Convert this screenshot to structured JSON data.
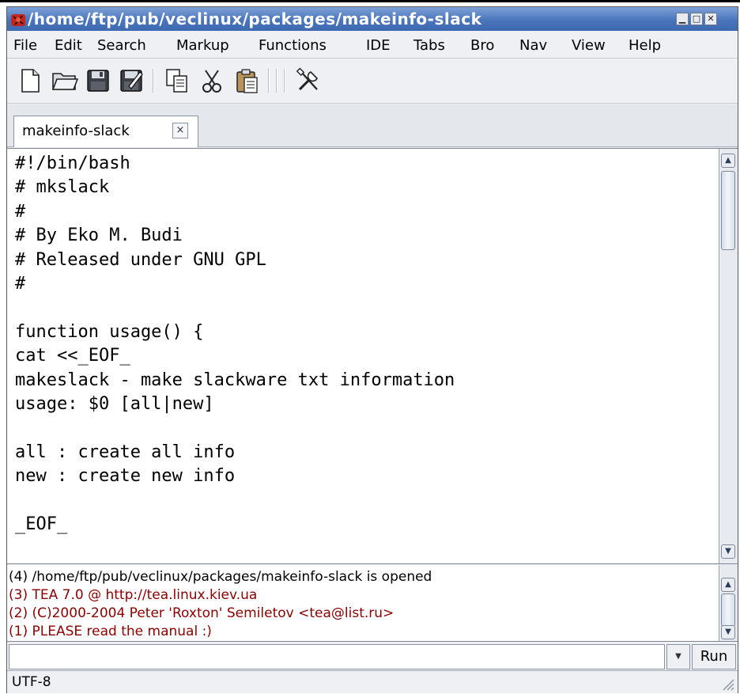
{
  "window": {
    "title": "/home/ftp/pub/veclinux/packages/makeinfo-slack",
    "controls": {
      "minimize": "▁",
      "maximize": "□",
      "close": "✕"
    }
  },
  "menubar": {
    "items": [
      "File",
      "Edit",
      "Search",
      "Markup",
      "Functions",
      "IDE",
      "Tabs",
      "Bro",
      "Nav",
      "View",
      "Help"
    ]
  },
  "toolbar": {
    "buttons": [
      "new-file-icon",
      "open-folder-icon",
      "save-icon",
      "save-as-icon",
      "copy-icon",
      "cut-icon",
      "paste-icon",
      "tools-icon"
    ]
  },
  "tabs": [
    {
      "label": "makeinfo-slack",
      "close": "×"
    }
  ],
  "editor": {
    "lines": [
      "#!/bin/bash",
      "# mkslack",
      "#",
      "# By Eko M. Budi",
      "# Released under GNU GPL",
      "#",
      "",
      "function usage() {",
      "cat <<_EOF_",
      "makeslack - make slackware txt information",
      "usage: $0 [all|new]",
      "",
      "all : create all info",
      "new : create new info",
      "",
      "_EOF_",
      ""
    ],
    "scroll_up": "▲",
    "scroll_down": "▼"
  },
  "log": {
    "lines": [
      {
        "text": "(4) /home/ftp/pub/veclinux/packages/makeinfo-slack is opened",
        "color": "#000000"
      },
      {
        "text": "(3) TEA 7.0 @ http://tea.linux.kiev.ua",
        "color": "#8b0000"
      },
      {
        "text": "(2) (C)2000-2004 Peter 'Roxton' Semiletov <tea@list.ru>",
        "color": "#8b0000"
      },
      {
        "text": "(1) PLEASE read the manual :)",
        "color": "#8b0000"
      }
    ],
    "scroll_up": "▲",
    "scroll_down": "▼"
  },
  "command": {
    "value": "",
    "dropdown": "▼",
    "run_label": "Run"
  },
  "status": {
    "encoding": "UTF-8"
  }
}
